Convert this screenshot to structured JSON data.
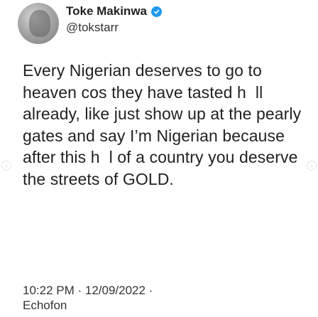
{
  "author": {
    "display_name": "Toke Makinwa",
    "verified_icon": "verified-badge-icon",
    "handle": "@tokstarr"
  },
  "tweet": {
    "text": "Every Nigerian deserves to go to heaven cos they have tasted h  ll already, like just show up at the pearly gates and say I’m Nigerian because after this h  l of a country you deserve the streets of GOLD."
  },
  "meta": {
    "timestamp": "10:22 PM · 12/09/2022 ·",
    "source": "Echofon"
  },
  "colors": {
    "accent": "#1d9bf0",
    "text": "#222222"
  }
}
